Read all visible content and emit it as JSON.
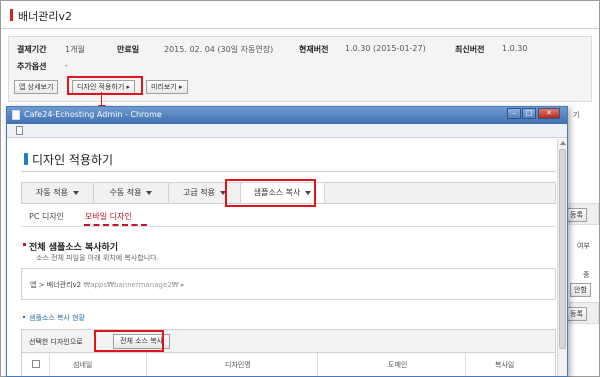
{
  "page": {
    "title": "배너관리v2"
  },
  "info": {
    "payment_period_label": "결제기간",
    "payment_period_value": "1개월",
    "expire_label": "만료일",
    "expire_value": "2015. 02. 04 (30일 자동연장)",
    "current_version_label": "현재버전",
    "current_version_value": "1.0.30 (2015-01-27)",
    "latest_version_label": "최신버전",
    "latest_version_value": "1.0.30",
    "extra_option_label": "추가옵션",
    "extra_option_value": "-"
  },
  "buttons": {
    "app_detail": "앱 상세보기",
    "apply_design": "디자인 적용하기",
    "preview": "미리보기"
  },
  "bg_right": {
    "frag_gi": "기",
    "register_1": "등록",
    "or_text": "여부",
    "mid_text": "중",
    "combine": "안함",
    "register_2": "등록"
  },
  "popup": {
    "window_title": "Cafe24-Echosting Admin - Chrome",
    "heading": "디자인 적용하기",
    "tabs": [
      {
        "label": "자동 적용"
      },
      {
        "label": "수동 적용"
      },
      {
        "label": "고급 적용"
      },
      {
        "label": "샘플소스 복사"
      }
    ],
    "subtabs": [
      "PC 디자인",
      "모바일 디자인"
    ],
    "section_title": "전체 샘플소스 복사하기",
    "section_desc": "소스 전체 파일을 아래 위치에 복사합니다.",
    "path_prefix": "앱 > 배너관리v2",
    "path_dim": "₩apps₩bannermanage2₩",
    "status_title": "샘플소스 복사 현황",
    "selected_label": "선택한 디자인으로",
    "copy_all_button": "전체 소스 복사",
    "table_headers": [
      "섬네일",
      "디자인명",
      "도메인",
      "복사일"
    ]
  },
  "colors": {
    "annotation_red": "#e0141b",
    "window_blue": "#3f6fb1",
    "active_subtab": "#c3122b"
  }
}
